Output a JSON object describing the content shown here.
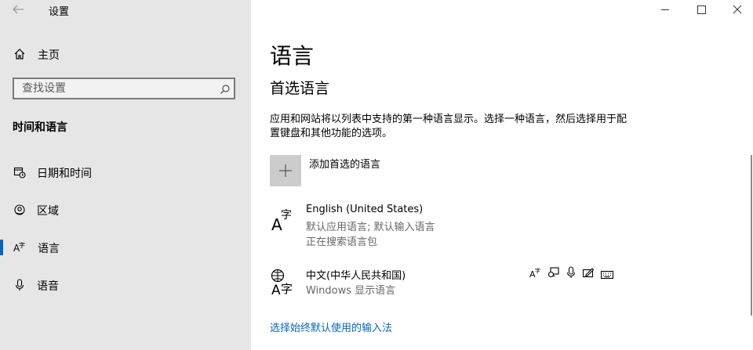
{
  "window": {
    "title": "设置",
    "controls": [
      "minimize",
      "maximize",
      "close"
    ]
  },
  "sidebar": {
    "home_label": "主页",
    "search": {
      "placeholder": "查找设置"
    },
    "section_title": "时间和语言",
    "items": [
      {
        "label": "日期和时间",
        "icon": "calendar-clock-icon"
      },
      {
        "label": "区域",
        "icon": "globe-icon"
      },
      {
        "label": "语言",
        "icon": "language-icon",
        "selected": true
      },
      {
        "label": "语音",
        "icon": "microphone-icon"
      }
    ]
  },
  "main": {
    "title": "语言",
    "subtitle": "首选语言",
    "description": "应用和网站将以列表中支持的第一种语言显示。选择一种语言，然后选择用于配置键盘和其他功能的选项。",
    "add_language_label": "添加首选的语言",
    "languages": [
      {
        "name": "English (United States)",
        "details": [
          "默认应用语言; 默认输入语言",
          "正在搜索语言包"
        ]
      },
      {
        "name": "中文(中华人民共和国)",
        "details": [
          "Windows 显示语言"
        ],
        "feature_icons": [
          "language-pack-icon",
          "speech-display-icon",
          "microphone-icon",
          "handwriting-icon",
          "keyboard-icon"
        ]
      }
    ],
    "default_input_link": "选择始终默认使用的输入法"
  },
  "colors": {
    "sidebar_bg": "#e6e6e6",
    "accent": "#0067c0",
    "tile_bg": "#cccccc"
  }
}
